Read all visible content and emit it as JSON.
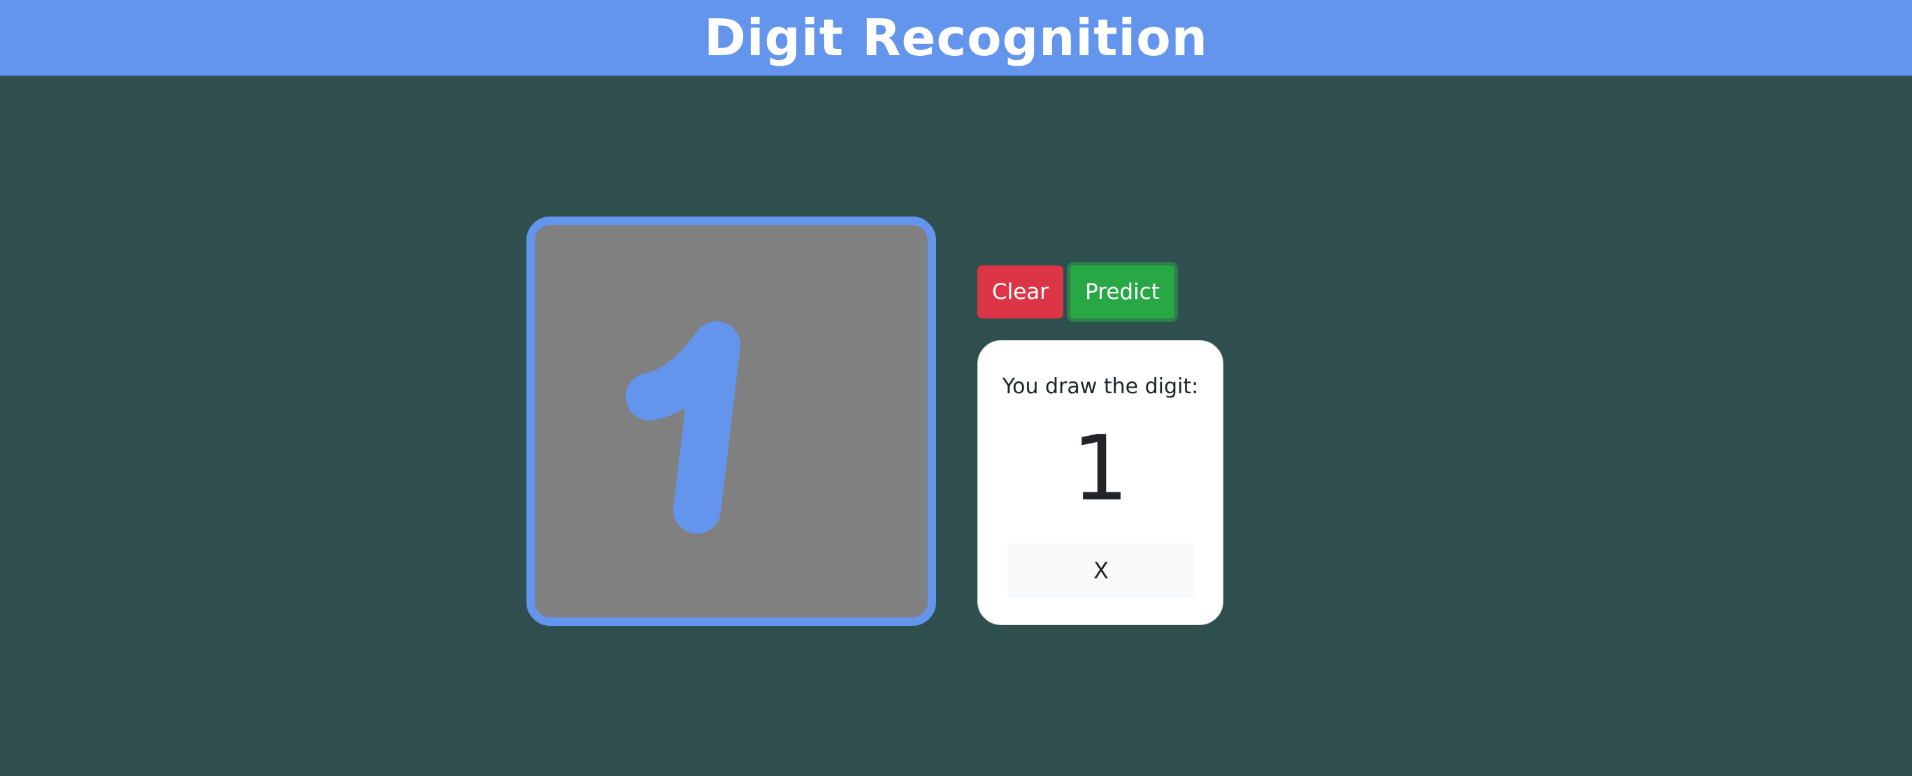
{
  "header": {
    "title": "Digit Recognition"
  },
  "canvas": {
    "drawn_stroke_color": "#6495ed",
    "background_color": "#808080"
  },
  "buttons": {
    "clear_label": "Clear",
    "predict_label": "Predict"
  },
  "result": {
    "label": "You draw the digit:",
    "digit": "1",
    "close_label": "X"
  },
  "colors": {
    "header": "#6495ed",
    "page_background": "#2f4f4f",
    "clear": "#dc3545",
    "predict": "#28a745"
  }
}
